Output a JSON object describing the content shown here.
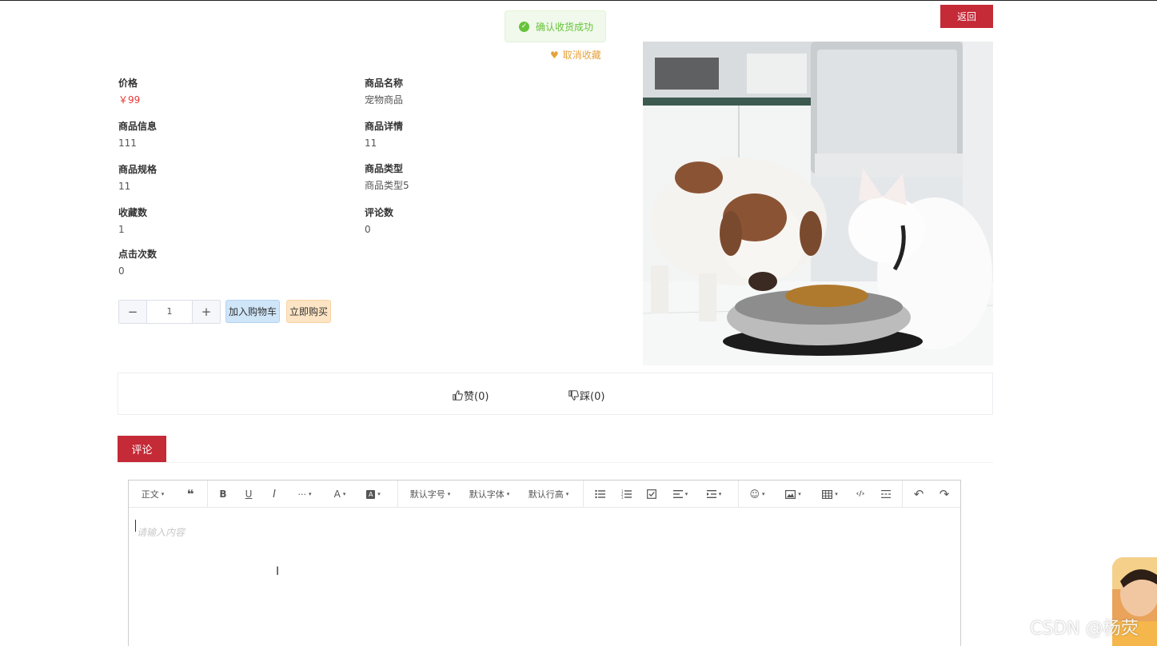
{
  "toast": {
    "message": "确认收货成功",
    "check_icon": "check-circle-icon",
    "color": "#67c23a"
  },
  "header": {
    "back_label": "返回",
    "favorite_label": "取消收藏",
    "favorite_icon": "heart-icon"
  },
  "info": {
    "price_label": "价格",
    "price_value": "￥99",
    "name_label": "商品名称",
    "name_value": "宠物商品",
    "desc_label": "商品信息",
    "desc_value": "111",
    "detail_label": "商品详情",
    "detail_value": "11",
    "spec_label": "商品规格",
    "spec_value": "11",
    "type_label": "商品类型",
    "type_value": "商品类型5",
    "fav_count_label": "收藏数",
    "fav_count_value": "1",
    "comment_count_label": "评论数",
    "comment_count_value": "0",
    "click_count_label": "点击次数",
    "click_count_value": "0"
  },
  "purchase": {
    "minus": "−",
    "quantity": "1",
    "plus": "+",
    "add_to_cart": "加入购物车",
    "buy_now": "立即购买"
  },
  "votes": {
    "like_label": "赞(0)",
    "dislike_label": "踩(0)",
    "like_icon": "thumbs-up-icon",
    "dislike_icon": "thumbs-down-icon"
  },
  "comment": {
    "tab_label": "评论",
    "placeholder": "请输入内容",
    "toolbar": {
      "paragraph": "正文",
      "font_size": "默认字号",
      "font_family": "默认字体",
      "line_height": "默认行高",
      "more": "···"
    }
  },
  "watermark": "CSDN @杨荧",
  "colors": {
    "brand_red": "#c52a37",
    "price_red": "#e53935",
    "favorite_orange": "#e6a23c"
  }
}
